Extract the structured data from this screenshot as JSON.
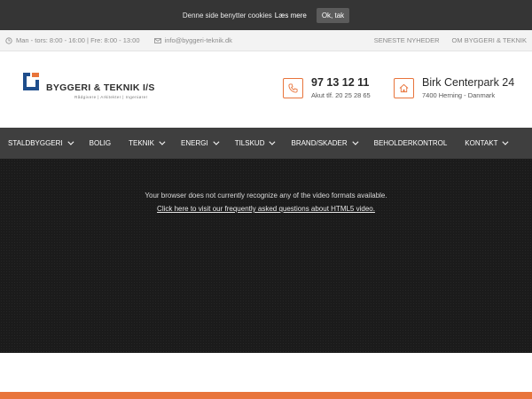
{
  "cookie": {
    "text": "Denne side benytter cookies",
    "more_link": "Læs mere",
    "ok_button": "Ok, tak"
  },
  "info_bar": {
    "hours": "Man - tors: 8:00 - 16:00 | Fre: 8:00 - 13:00",
    "email": "info@byggeri-teknik.dk",
    "links": [
      "SENESTE NYHEDER",
      "OM BYGGERI & TEKNIK"
    ]
  },
  "logo": {
    "name": "BYGGERI & TEKNIK I/S",
    "tagline": "Rådgivere | Arkitekter | Ingeniører"
  },
  "phone": {
    "number": "97 13 12 11",
    "sub": "Akut tlf. 20 25 28 65"
  },
  "address": {
    "street": "Birk Centerpark 24",
    "city": "7400 Herning - Danmark"
  },
  "nav": {
    "items": [
      {
        "label": "STALDBYGGERI",
        "dropdown": true
      },
      {
        "label": "BOLIG",
        "dropdown": false
      },
      {
        "label": "TEKNIK",
        "dropdown": true
      },
      {
        "label": "ENERGI",
        "dropdown": true
      },
      {
        "label": "TILSKUD",
        "dropdown": true
      },
      {
        "label": "BRAND/SKADER",
        "dropdown": true
      },
      {
        "label": "BEHOLDERKONTROL",
        "dropdown": false
      },
      {
        "label": "KONTAKT",
        "dropdown": true
      }
    ]
  },
  "video": {
    "message": "Your browser does not currently recognize any of the video formats available.",
    "link": "Click here to visit our frequently asked questions about HTML5 video."
  },
  "colors": {
    "accent": "#e8743b",
    "nav_bg": "#3f3f3f",
    "cookie_bg": "#353535",
    "logo_blue": "#1f4e8c"
  }
}
